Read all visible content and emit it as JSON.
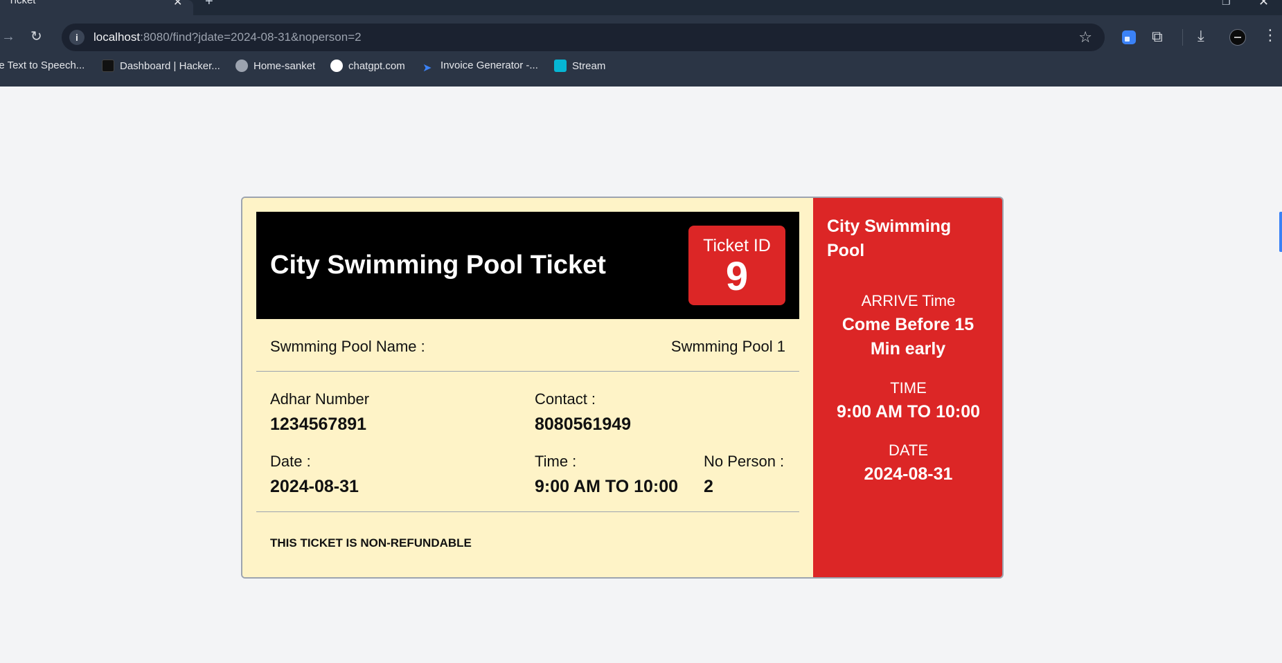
{
  "browser": {
    "tab_title": "Ticket",
    "url_host": "localhost",
    "url_path": ":8080/find?jdate=2024-08-31&noperson=2",
    "bookmarks": [
      {
        "label": "ee Text to Speech...",
        "icon": "page-icon",
        "color": "#2b3545"
      },
      {
        "label": "Dashboard | Hacker...",
        "icon": "hackerrank-icon",
        "color": "#111111"
      },
      {
        "label": "Home-sanket",
        "icon": "globe-icon",
        "color": "#9ca3af"
      },
      {
        "label": "chatgpt.com",
        "icon": "chatgpt-icon",
        "color": "#ffffff"
      },
      {
        "label": "Invoice Generator -...",
        "icon": "send-icon",
        "color": "#2563eb"
      },
      {
        "label": "Stream",
        "icon": "stream-icon",
        "color": "#06b6d4"
      }
    ]
  },
  "ticket": {
    "title": "City Swimming Pool Ticket",
    "id_label": "Ticket ID",
    "id_value": "9",
    "pool_label": "Swmming Pool Name :",
    "pool_value": "Swmming Pool 1",
    "adhar_label": "Adhar Number",
    "adhar_value": "1234567891",
    "contact_label": "Contact :",
    "contact_value": "8080561949",
    "date_label": "Date :",
    "date_value": "2024-08-31",
    "time_label": "Time :",
    "time_value": "9:00 AM TO 10:00",
    "persons_label": "No Person :",
    "persons_value": "2",
    "notice": "THIS TICKET IS NON-REFUNDABLE"
  },
  "stub": {
    "title": "City Swimming Pool",
    "arrive_label": "ARRIVE Time",
    "arrive_value": "Come Before 15 Min early",
    "time_label": "TIME",
    "time_value": "9:00 AM TO 10:00",
    "date_label": "DATE",
    "date_value": "2024-08-31"
  },
  "colors": {
    "ticket_bg": "#fef3c7",
    "header_bg": "#000000",
    "accent_red": "#dc2626"
  }
}
